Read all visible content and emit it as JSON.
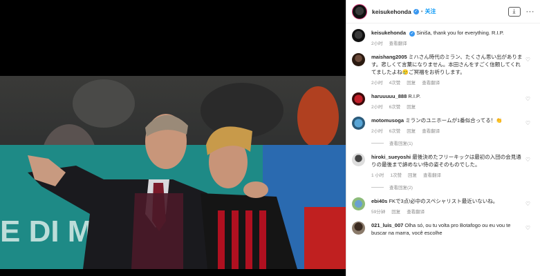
{
  "post": {
    "username": "keisukehonda",
    "follow_label": "关注",
    "download_icon": "download-icon",
    "more_icon": "more-options-icon",
    "caption": "Siniša, thank you for everything. R.I.P.",
    "caption_time": "2小时",
    "translate_label": "查看翻译"
  },
  "photo": {
    "banner_text": "E DI MILANO"
  },
  "comments": [
    {
      "user": "maishang2005",
      "text": "ミハさん時代のミラン、たくさん思い出があります。悲しくて言葉になりません。本田さんをすごく信頼してくれてましたよね🥲ご冥福をお祈りします。",
      "time": "2小时",
      "likes": "4次赞",
      "reply": "回复",
      "translate": "查看翻译"
    },
    {
      "user": "haruuuuu_888",
      "text": "R.I.P.",
      "time": "2小时",
      "likes": "6次赞",
      "reply": "回复"
    },
    {
      "user": "motomusoga",
      "text": "ミランのユニホームが1番似合ってる！👏",
      "time": "2小时",
      "likes": "6次赞",
      "reply": "回复",
      "translate": "查看翻译",
      "view_replies": "查看回复(1)"
    },
    {
      "user": "hiroki_sueyoshi",
      "text": "最後決めたフリーキックは最初の入団の会見通りの最後まで諦めない侍の姿そのものでした。",
      "time": "1 小时",
      "likes": "1次赞",
      "reply": "回复",
      "translate": "查看翻译",
      "view_replies": "查看回复(2)"
    },
    {
      "user": "ebi40s",
      "text": "FKで3点!必中のスペシャリスト最近いないね。",
      "time": "59分钟",
      "reply": "回复",
      "translate": "查看翻译"
    },
    {
      "user": "021_luis_007",
      "text": "Olha só, ou tu volta pro Botafogo ou eu vou te buscar na marra, você escolhe",
      "time": "",
      "reply": "",
      "translate": ""
    }
  ]
}
